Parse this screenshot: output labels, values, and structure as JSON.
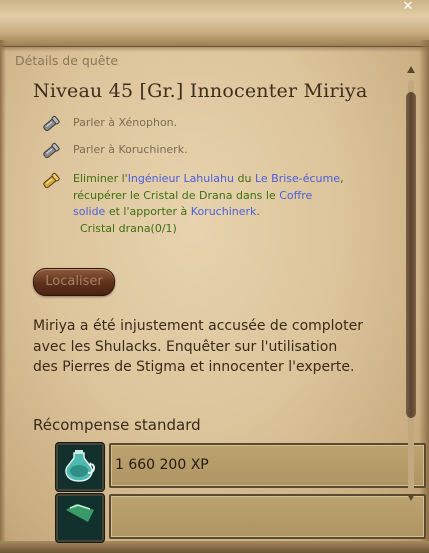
{
  "window": {
    "title": "Détails de quête",
    "close_glyph": "✕"
  },
  "quest": {
    "title": "Niveau 45 [Gr.] Innocenter Miriya",
    "objectives": [
      {
        "state": "done",
        "icon": "scroll-icon",
        "text": "Parler à Xénophon."
      },
      {
        "state": "done",
        "icon": "scroll-icon",
        "text": "Parler à Koruchinerk."
      }
    ],
    "active": {
      "icon": "scroll-gold-icon",
      "p1": "Eliminer l'",
      "l1": "Ingénieur Lahulahu",
      "p2": " du ",
      "l2": "Le Brise-écume",
      "p3": ",",
      "p4": "récupérer le Cristal de Drana dans le ",
      "l3": "Coffre",
      "l4": "solide",
      "p5": " et l'apporter à ",
      "l5": "Koruchinerk",
      "p6": ".",
      "count": "Cristal drana(0/1)"
    },
    "locate_label": "Localiser",
    "description": "Miriya a été injustement accusée de comploter avec les Shulacks. Enquêter sur l'utilisation des Pierres de Stigma et innocenter l'experte.",
    "reward_title": "Récompense standard",
    "rewards": [
      {
        "icon": "potion-icon",
        "label": "1 660 200 XP"
      },
      {
        "icon": "item-icon",
        "label": ""
      }
    ]
  },
  "colors": {
    "link": "#4c5fd8",
    "active_text": "#3e6f10",
    "parchment": "#dcc49b"
  }
}
